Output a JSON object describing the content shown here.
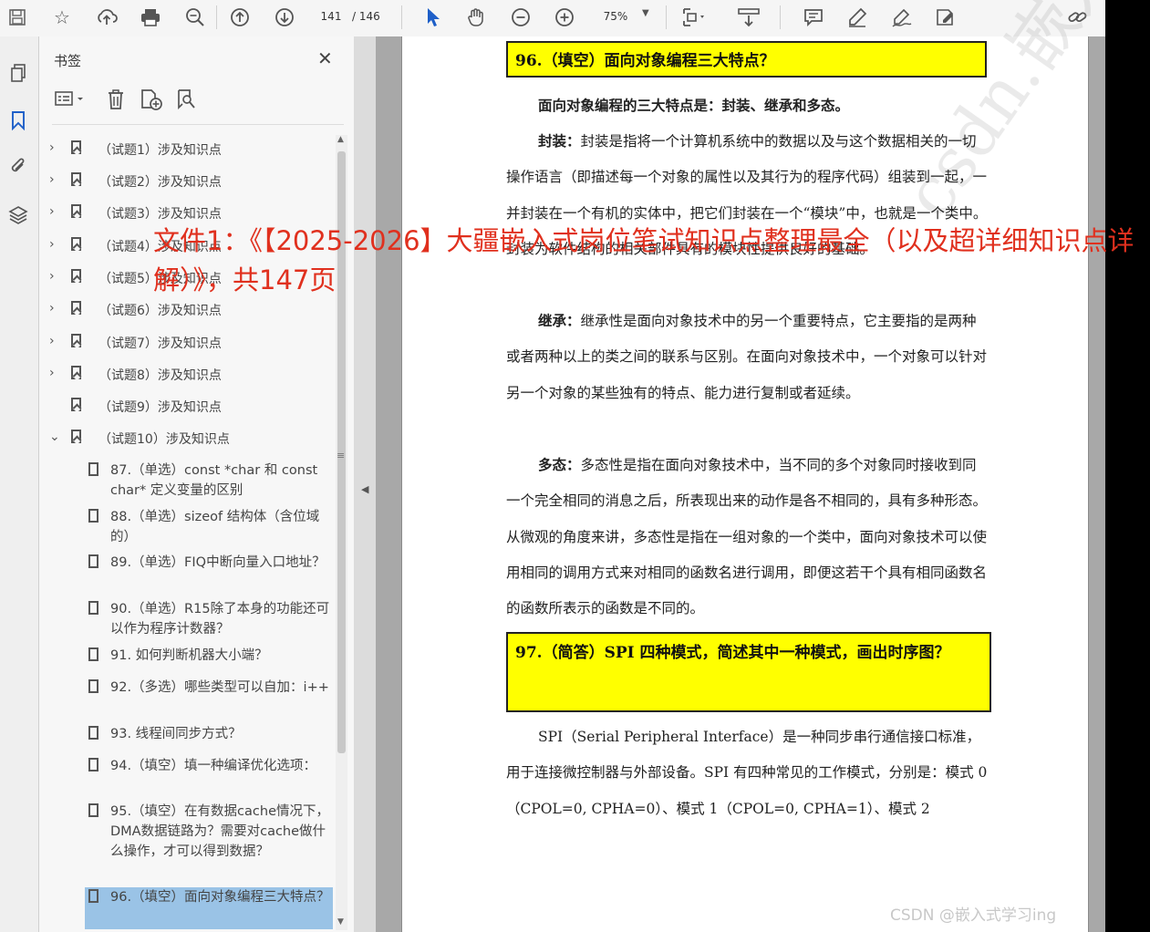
{
  "toolbar": {
    "page_current": "141",
    "page_total": "/ 146",
    "zoom": "75%",
    "icons": [
      "save-icon",
      "star-icon",
      "upload-icon",
      "print-icon",
      "zoom-out-magnifier-icon",
      "page-up-icon",
      "page-down-icon",
      "select-cursor-icon",
      "hand-icon",
      "zoom-out-icon",
      "zoom-in-icon",
      "zoom-dropdown-icon",
      "fit-page-icon",
      "scroll-mode-icon",
      "comment-icon",
      "highlight-pen-icon",
      "sign-icon",
      "fill-sign-icon",
      "share-link-icon"
    ]
  },
  "nav_rail": {
    "icons": [
      "pages-icon",
      "bookmark-icon",
      "attachment-icon",
      "layers-icon"
    ]
  },
  "bookmarks": {
    "title": "书签",
    "close": "✕",
    "top_items": [
      {
        "label": "（试题1）涉及知识点",
        "expand": "›"
      },
      {
        "label": "（试题2）涉及知识点",
        "expand": "›"
      },
      {
        "label": "（试题3）涉及知识点",
        "expand": "›"
      },
      {
        "label": "（试题4）涉及知识点",
        "expand": "›"
      },
      {
        "label": "（试题5）涉及知识点",
        "expand": "›"
      },
      {
        "label": "（试题6）涉及知识点",
        "expand": "›"
      },
      {
        "label": "（试题7）涉及知识点",
        "expand": "›"
      },
      {
        "label": "（试题8）涉及知识点",
        "expand": "›"
      },
      {
        "label": "（试题9）涉及知识点",
        "expand": ""
      },
      {
        "label": "（试题10）涉及知识点",
        "expand": "⌄"
      }
    ],
    "sub_items": [
      {
        "label": "87.（单选）const *char 和 const char* 定义变量的区别"
      },
      {
        "label": "88.（单选）sizeof 结构体（含位域的）"
      },
      {
        "label": "89.（单选）FIQ中断向量入口地址？"
      },
      {
        "label": "90.（单选）R15除了本身的功能还可以作为程序计数器？"
      },
      {
        "label": "91. 如何判断机器大小端？"
      },
      {
        "label": "92.（多选）哪些类型可以自加：i++"
      },
      {
        "label": "93. 线程间同步方式？"
      },
      {
        "label": "94.（填空）填一种编译优化选项："
      },
      {
        "label": "95.（填空）在有数据cache情况下，DMA数据链路为？需要对cache做什么操作，才可以得到数据？"
      },
      {
        "label": "96.（填空）面向对象编程三大特点？"
      }
    ]
  },
  "document": {
    "q96_title": "96.（填空）面向对象编程三大特点？",
    "p_intro": "面向对象编程的三大特点是：封装、继承和多态。",
    "p_encap_head": "封装：",
    "p_encap_body": "封装是指将一个计算机系统中的数据以及与这个数据相关的一切操作语言（即描述每一个对象的属性以及其行为的程序代码）组装到一起，一并封装在一个有机的实体中，把它们封装在一个“模块”中，也就是一个类中。封装为软件结构的相关部件具有的模块性提供良好的基础。",
    "p_inherit_head": "继承：",
    "p_inherit_body": "继承性是面向对象技术中的另一个重要特点，它主要指的是两种或者两种以上的类之间的联系与区别。在面向对象技术中，一个对象可以针对另一个对象的某些独有的特点、能力进行复制或者延续。",
    "p_poly_head": "多态：",
    "p_poly_body": "多态性是指在面向对象技术中，当不同的多个对象同时接收到同一个完全相同的消息之后，所表现出来的动作是各不相同的，具有多种形态。从微观的角度来讲，多态性是指在一组对象的一个类中，面向对象技术可以使用相同的调用方式来对相同的函数名进行调用，即便这若干个具有相同函数名的函数所表示的函数是不同的。",
    "q97_title": "97.（简答）SPI 四种模式，简述其中一种模式，画出时序图？",
    "p_spi": "SPI（Serial Peripheral Interface）是一种同步串行通信接口标准，用于连接微控制器与外部设备。SPI 有四种常见的工作模式，分别是：模式 0（CPOL=0, CPHA=0）、模式 1（CPOL=0, CPHA=1）、模式 2",
    "watermark": "csdn.嵌入式学习ing"
  },
  "overlay": {
    "text": "文件1：《【2025-2026】大疆嵌入式岗位笔试知识点整理最全（以及超详细知识点详解）》，共147页"
  },
  "footer_watermark": "CSDN @嵌入式学习ing",
  "colors": {
    "overlay_red": "#e0301e",
    "highlight_yellow": "#ffff00",
    "selected_bookmark": "#9ac3e6",
    "accent_blue": "#1e5fc8"
  }
}
